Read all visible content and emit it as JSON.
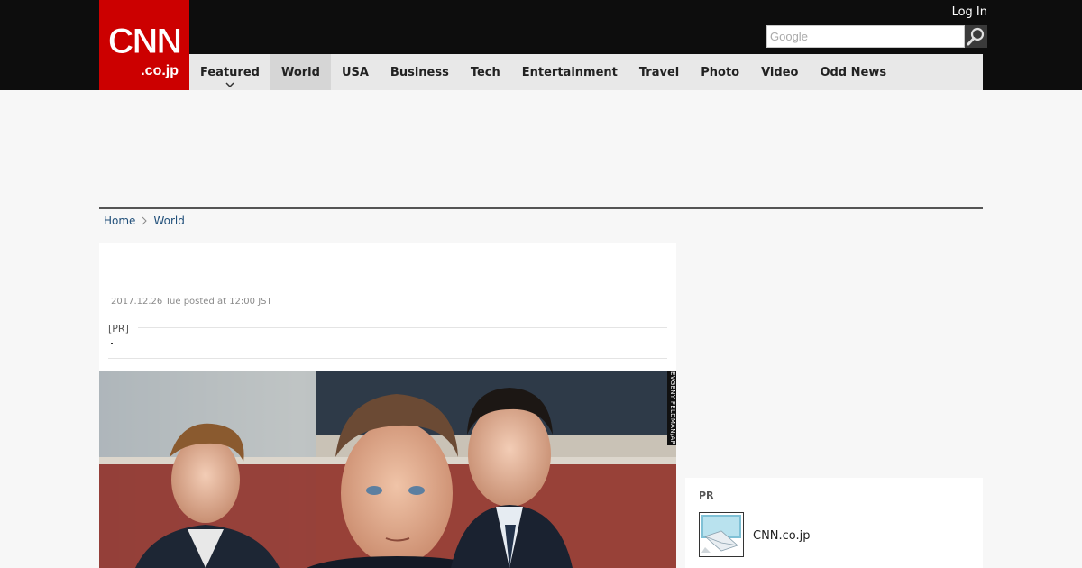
{
  "logo": {
    "main": "CNN",
    "sub": ".co.jp"
  },
  "header": {
    "login_label": "Log In"
  },
  "search": {
    "placeholder": "Google"
  },
  "nav": {
    "items": [
      {
        "label": "Featured"
      },
      {
        "label": "World"
      },
      {
        "label": "USA"
      },
      {
        "label": "Business"
      },
      {
        "label": "Tech"
      },
      {
        "label": "Entertainment"
      },
      {
        "label": "Travel"
      },
      {
        "label": "Photo"
      },
      {
        "label": "Video"
      },
      {
        "label": "Odd News"
      }
    ],
    "active": "World"
  },
  "breadcrumb": {
    "home": "Home",
    "section": "World"
  },
  "article": {
    "posted": "2017.12.26 Tue posted at 12:00 JST",
    "pr_label": "[PR]",
    "photo_credit": "EVGENY FELDMAN/AP"
  },
  "sidebar": {
    "pr_heading": "PR",
    "link_label": "CNN.co.jp"
  },
  "colors": {
    "brand_red": "#cc0000",
    "topbar": "#0d0d0d",
    "nav_bg": "#e8e8e8",
    "link_blue": "#1f4e79"
  }
}
